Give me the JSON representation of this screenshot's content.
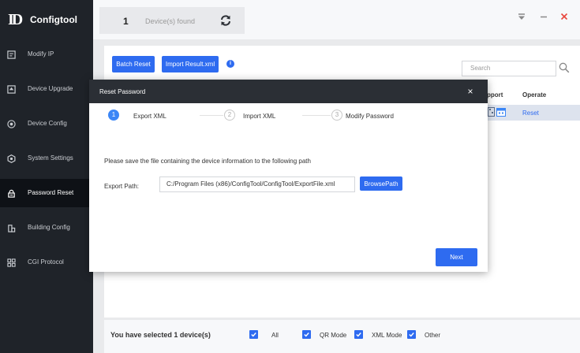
{
  "app": {
    "name": "Configtool"
  },
  "sidebar": {
    "items": [
      {
        "label": "Modify IP",
        "icon": "edit-icon"
      },
      {
        "label": "Device Upgrade",
        "icon": "upgrade-icon"
      },
      {
        "label": "Device Config",
        "icon": "device-config-icon"
      },
      {
        "label": "System Settings",
        "icon": "system-settings-icon"
      },
      {
        "label": "Password Reset",
        "icon": "lock-icon",
        "active": true
      },
      {
        "label": "Building Config",
        "icon": "building-icon"
      },
      {
        "label": "CGI Protocol",
        "icon": "grid-icon"
      }
    ]
  },
  "topbar": {
    "count": "1",
    "found_label": "Device(s) found"
  },
  "toolbar": {
    "batch_reset": "Batch Reset",
    "import_result": "Import Result.xml",
    "search_placeholder": "Search"
  },
  "table": {
    "headers": [
      "pport",
      "Operate"
    ],
    "row": {
      "operate": "Reset"
    }
  },
  "bottom": {
    "selected_text": "You have selected 1  device(s)",
    "options": [
      {
        "label": "All",
        "checked": true
      },
      {
        "label": "QR Mode",
        "checked": true
      },
      {
        "label": "XML Mode",
        "checked": true
      },
      {
        "label": "Other",
        "checked": true
      }
    ]
  },
  "modal": {
    "title": "Reset Password",
    "close": "×",
    "steps": [
      {
        "number": "1",
        "label": "Export XML",
        "state": "active"
      },
      {
        "number": "2",
        "label": "Import XML",
        "state": "inactive"
      },
      {
        "number": "3",
        "label": "Modify Password",
        "state": "inactive"
      }
    ],
    "instruction": "Please save the file containing the device information to the following path",
    "path_label": "Export Path:",
    "path_value": "C:/Program Files (x86)/ConfigTool/ConfigTool/ExportFile.xml",
    "browse_button": "BrowsePath",
    "next_button": "Next"
  },
  "colors": {
    "accent": "#2e6bf0",
    "sidebar_bg": "#1f2329",
    "close_red": "#e8463c"
  }
}
